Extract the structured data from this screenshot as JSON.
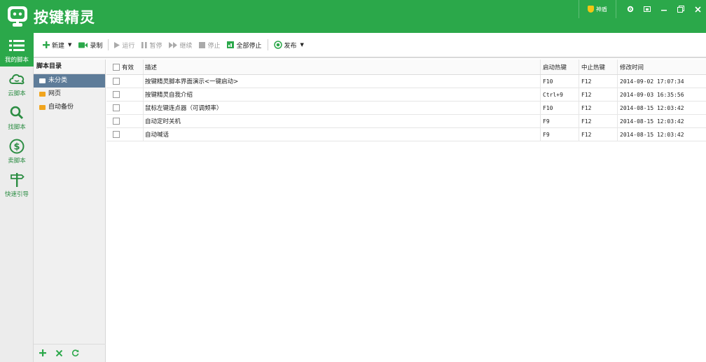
{
  "app": {
    "title": "按键精灵",
    "shield_label": "神盾"
  },
  "window_controls": [
    "settings",
    "skin",
    "minimize",
    "restore",
    "close"
  ],
  "nav": [
    {
      "label": "我的脚本",
      "icon": "list-icon",
      "active": true
    },
    {
      "label": "云脚本",
      "icon": "cloud-icon",
      "active": false
    },
    {
      "label": "找脚本",
      "icon": "search-icon",
      "active": false
    },
    {
      "label": "卖脚本",
      "icon": "dollar-icon",
      "active": false
    },
    {
      "label": "快速引导",
      "icon": "signpost-icon",
      "active": false
    }
  ],
  "toolbar": {
    "new": "新建",
    "record": "录制",
    "run": "运行",
    "pause": "暂停",
    "resume": "继续",
    "stop": "停止",
    "stop_all": "全部停止",
    "publish": "发布"
  },
  "directory": {
    "header": "脚本目录",
    "items": [
      "未分类",
      "网页",
      "自动备份"
    ],
    "selected": 0
  },
  "table": {
    "headers": {
      "enabled": "有效",
      "desc": "描述",
      "start_hotkey": "启动热键",
      "stop_hotkey": "中止热键",
      "modified": "修改时间"
    },
    "rows": [
      {
        "desc": "按键精灵脚本界面演示<一键启动>",
        "start": "F10",
        "stop": "F12",
        "time": "2014-09-02 17:07:34"
      },
      {
        "desc": "按键精灵自我介绍",
        "start": "Ctrl+9",
        "stop": "F12",
        "time": "2014-09-03 16:35:56"
      },
      {
        "desc": "鼠标左键连点器（可调频率）",
        "start": "F10",
        "stop": "F12",
        "time": "2014-08-15 12:03:42"
      },
      {
        "desc": "自动定时关机",
        "start": "F9",
        "stop": "F12",
        "time": "2014-08-15 12:03:42"
      },
      {
        "desc": "自动喊话",
        "start": "F9",
        "stop": "F12",
        "time": "2014-08-15 12:03:42"
      }
    ]
  },
  "colors": {
    "brand": "#2ba84a",
    "selected": "#5e7c99",
    "folder": "#f1a51e",
    "shield": "#f3c614"
  }
}
